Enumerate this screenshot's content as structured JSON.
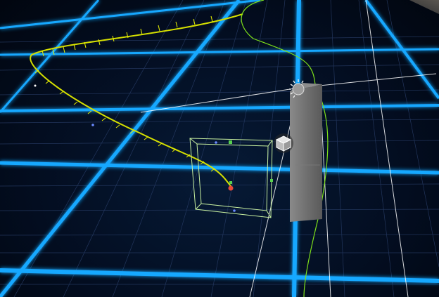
{
  "viewport": {
    "view_type": "perspective",
    "grid_color": "#1aa8ff",
    "fine_grid_color": "#2a3f6a",
    "background": "#030d20"
  },
  "objects": {
    "path_curve": {
      "color": "#d6e000",
      "kind": "spline"
    },
    "trajectory_curve": {
      "color": "#7ee01a",
      "kind": "spline"
    },
    "selection_box": {
      "color": "#c8f0a0",
      "kind": "bounding-box"
    },
    "pillar": {
      "color": "#6e6e6e",
      "kind": "box-mesh"
    },
    "light_gizmo": {
      "icon": "sun-icon"
    },
    "camera_gizmo": {
      "icon": "cube-icon"
    },
    "pivot_point": {
      "color": "#e84a3a"
    }
  }
}
